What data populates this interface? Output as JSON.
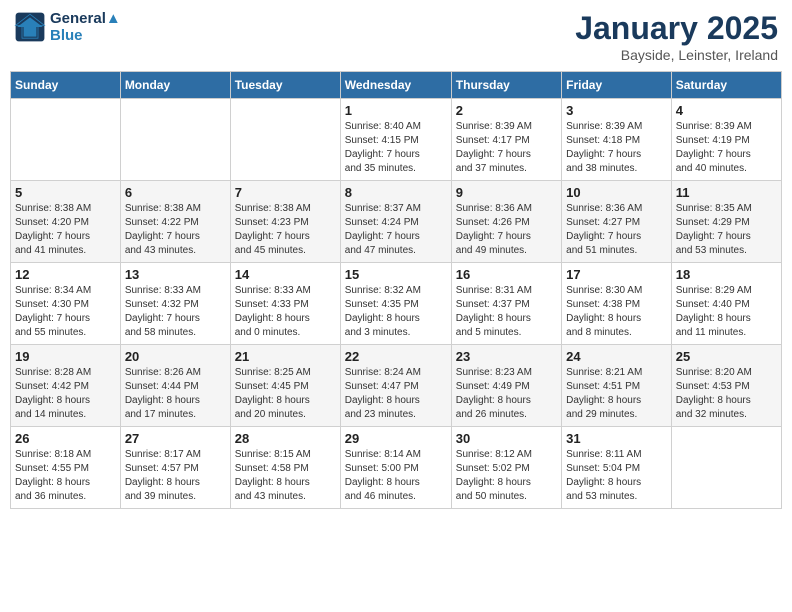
{
  "header": {
    "logo_line1": "General",
    "logo_line2": "Blue",
    "month": "January 2025",
    "location": "Bayside, Leinster, Ireland"
  },
  "weekdays": [
    "Sunday",
    "Monday",
    "Tuesday",
    "Wednesday",
    "Thursday",
    "Friday",
    "Saturday"
  ],
  "weeks": [
    [
      {
        "day": "",
        "info": ""
      },
      {
        "day": "",
        "info": ""
      },
      {
        "day": "",
        "info": ""
      },
      {
        "day": "1",
        "info": "Sunrise: 8:40 AM\nSunset: 4:15 PM\nDaylight: 7 hours\nand 35 minutes."
      },
      {
        "day": "2",
        "info": "Sunrise: 8:39 AM\nSunset: 4:17 PM\nDaylight: 7 hours\nand 37 minutes."
      },
      {
        "day": "3",
        "info": "Sunrise: 8:39 AM\nSunset: 4:18 PM\nDaylight: 7 hours\nand 38 minutes."
      },
      {
        "day": "4",
        "info": "Sunrise: 8:39 AM\nSunset: 4:19 PM\nDaylight: 7 hours\nand 40 minutes."
      }
    ],
    [
      {
        "day": "5",
        "info": "Sunrise: 8:38 AM\nSunset: 4:20 PM\nDaylight: 7 hours\nand 41 minutes."
      },
      {
        "day": "6",
        "info": "Sunrise: 8:38 AM\nSunset: 4:22 PM\nDaylight: 7 hours\nand 43 minutes."
      },
      {
        "day": "7",
        "info": "Sunrise: 8:38 AM\nSunset: 4:23 PM\nDaylight: 7 hours\nand 45 minutes."
      },
      {
        "day": "8",
        "info": "Sunrise: 8:37 AM\nSunset: 4:24 PM\nDaylight: 7 hours\nand 47 minutes."
      },
      {
        "day": "9",
        "info": "Sunrise: 8:36 AM\nSunset: 4:26 PM\nDaylight: 7 hours\nand 49 minutes."
      },
      {
        "day": "10",
        "info": "Sunrise: 8:36 AM\nSunset: 4:27 PM\nDaylight: 7 hours\nand 51 minutes."
      },
      {
        "day": "11",
        "info": "Sunrise: 8:35 AM\nSunset: 4:29 PM\nDaylight: 7 hours\nand 53 minutes."
      }
    ],
    [
      {
        "day": "12",
        "info": "Sunrise: 8:34 AM\nSunset: 4:30 PM\nDaylight: 7 hours\nand 55 minutes."
      },
      {
        "day": "13",
        "info": "Sunrise: 8:33 AM\nSunset: 4:32 PM\nDaylight: 7 hours\nand 58 minutes."
      },
      {
        "day": "14",
        "info": "Sunrise: 8:33 AM\nSunset: 4:33 PM\nDaylight: 8 hours\nand 0 minutes."
      },
      {
        "day": "15",
        "info": "Sunrise: 8:32 AM\nSunset: 4:35 PM\nDaylight: 8 hours\nand 3 minutes."
      },
      {
        "day": "16",
        "info": "Sunrise: 8:31 AM\nSunset: 4:37 PM\nDaylight: 8 hours\nand 5 minutes."
      },
      {
        "day": "17",
        "info": "Sunrise: 8:30 AM\nSunset: 4:38 PM\nDaylight: 8 hours\nand 8 minutes."
      },
      {
        "day": "18",
        "info": "Sunrise: 8:29 AM\nSunset: 4:40 PM\nDaylight: 8 hours\nand 11 minutes."
      }
    ],
    [
      {
        "day": "19",
        "info": "Sunrise: 8:28 AM\nSunset: 4:42 PM\nDaylight: 8 hours\nand 14 minutes."
      },
      {
        "day": "20",
        "info": "Sunrise: 8:26 AM\nSunset: 4:44 PM\nDaylight: 8 hours\nand 17 minutes."
      },
      {
        "day": "21",
        "info": "Sunrise: 8:25 AM\nSunset: 4:45 PM\nDaylight: 8 hours\nand 20 minutes."
      },
      {
        "day": "22",
        "info": "Sunrise: 8:24 AM\nSunset: 4:47 PM\nDaylight: 8 hours\nand 23 minutes."
      },
      {
        "day": "23",
        "info": "Sunrise: 8:23 AM\nSunset: 4:49 PM\nDaylight: 8 hours\nand 26 minutes."
      },
      {
        "day": "24",
        "info": "Sunrise: 8:21 AM\nSunset: 4:51 PM\nDaylight: 8 hours\nand 29 minutes."
      },
      {
        "day": "25",
        "info": "Sunrise: 8:20 AM\nSunset: 4:53 PM\nDaylight: 8 hours\nand 32 minutes."
      }
    ],
    [
      {
        "day": "26",
        "info": "Sunrise: 8:18 AM\nSunset: 4:55 PM\nDaylight: 8 hours\nand 36 minutes."
      },
      {
        "day": "27",
        "info": "Sunrise: 8:17 AM\nSunset: 4:57 PM\nDaylight: 8 hours\nand 39 minutes."
      },
      {
        "day": "28",
        "info": "Sunrise: 8:15 AM\nSunset: 4:58 PM\nDaylight: 8 hours\nand 43 minutes."
      },
      {
        "day": "29",
        "info": "Sunrise: 8:14 AM\nSunset: 5:00 PM\nDaylight: 8 hours\nand 46 minutes."
      },
      {
        "day": "30",
        "info": "Sunrise: 8:12 AM\nSunset: 5:02 PM\nDaylight: 8 hours\nand 50 minutes."
      },
      {
        "day": "31",
        "info": "Sunrise: 8:11 AM\nSunset: 5:04 PM\nDaylight: 8 hours\nand 53 minutes."
      },
      {
        "day": "",
        "info": ""
      }
    ]
  ]
}
